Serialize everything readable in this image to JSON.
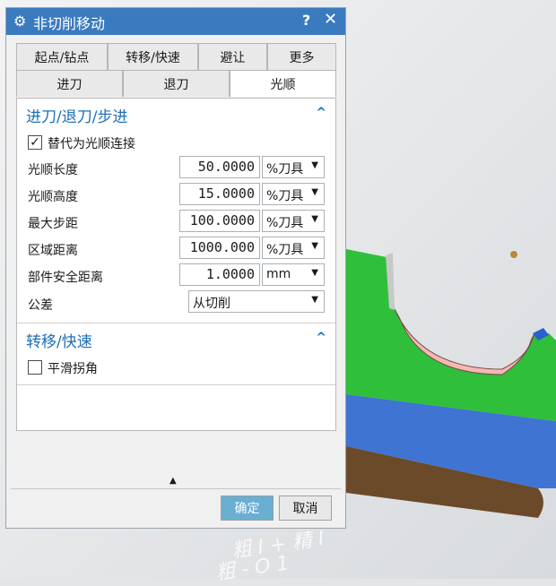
{
  "dialog": {
    "title": "非切削移动",
    "help": "?",
    "close": "✕"
  },
  "tabs_top": [
    "起点/钻点",
    "转移/快速",
    "避让",
    "更多"
  ],
  "tabs_bottom": [
    "进刀",
    "退刀",
    "光顺"
  ],
  "active_tab": "光顺",
  "section1": {
    "title": "进刀/退刀/步进",
    "replace_checkbox": {
      "label": "替代为光顺连接",
      "checked": true
    },
    "rows": [
      {
        "label": "光顺长度",
        "value": "50.0000",
        "unit": "%刀具"
      },
      {
        "label": "光顺高度",
        "value": "15.0000",
        "unit": "%刀具"
      },
      {
        "label": "最大步距",
        "value": "100.0000",
        "unit": "%刀具"
      },
      {
        "label": "区域距离",
        "value": "1000.000",
        "unit": "%刀具"
      },
      {
        "label": "部件安全距离",
        "value": "1.0000",
        "unit": "mm"
      }
    ],
    "tolerance": {
      "label": "公差",
      "value": "从切削"
    }
  },
  "section2": {
    "title": "转移/快速",
    "smooth_corner": {
      "label": "平滑拐角",
      "checked": false
    }
  },
  "footer": {
    "ok": "确定",
    "cancel": "取消"
  },
  "watermark": [
    "粗 I + 精 I",
    "粗 - O   1"
  ]
}
